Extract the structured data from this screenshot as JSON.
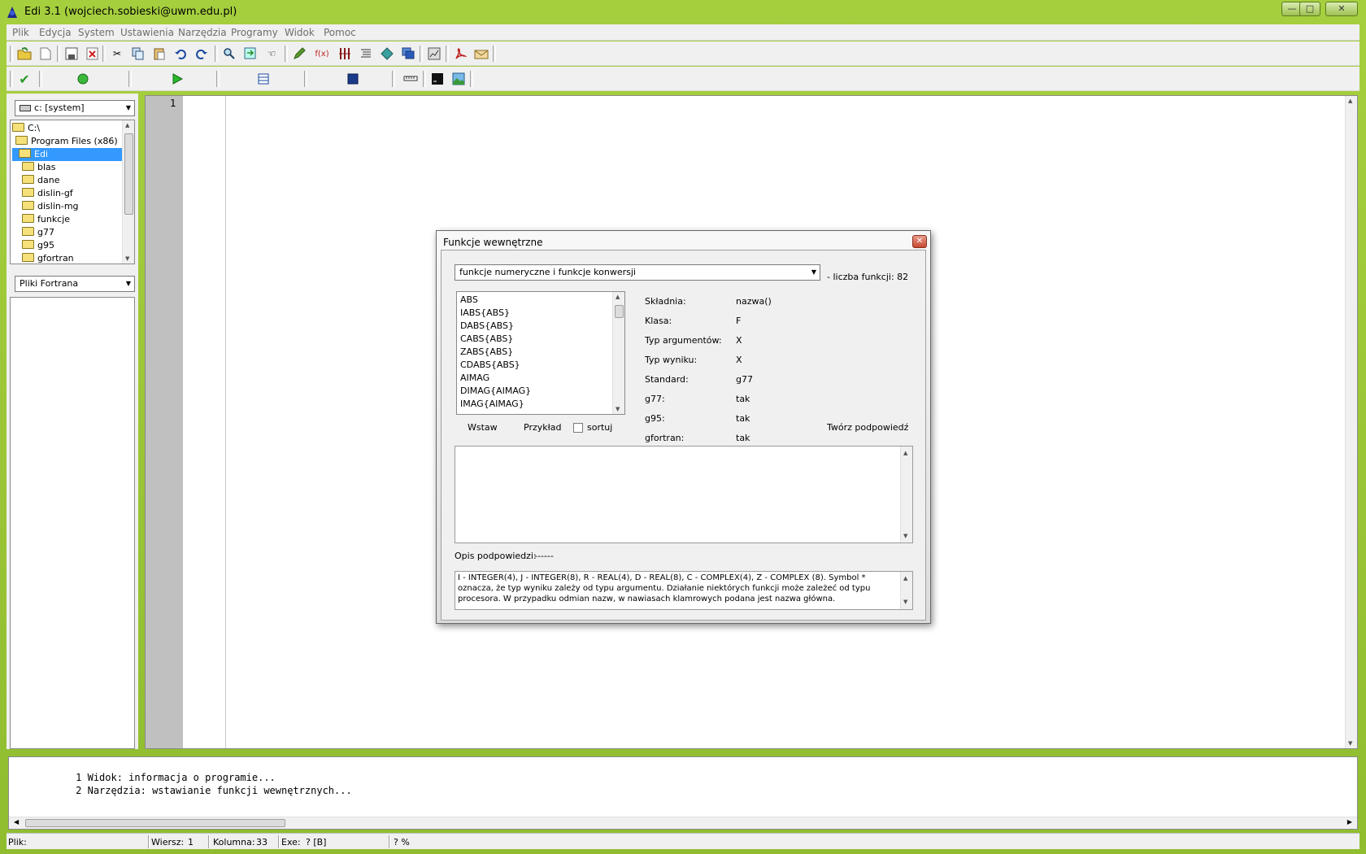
{
  "window": {
    "title": "Edi 3.1 (wojciech.sobieski@uwm.edu.pl)",
    "controls": {
      "minimize": "—",
      "maximize": "□",
      "close": "✕"
    }
  },
  "menu": [
    "Plik",
    "Edycja",
    "System",
    "Ustawienia",
    "Narzędzia",
    "Programy",
    "Widok",
    "Pomoc"
  ],
  "toolbar": {
    "func_icon": "f(x)"
  },
  "left_panel": {
    "drive": "c: [system]",
    "tree": [
      {
        "label": "C:\\",
        "indent": 0,
        "open": true
      },
      {
        "label": "Program Files (x86)",
        "indent": 0,
        "open": true
      },
      {
        "label": "Edi",
        "indent": 1,
        "open": true,
        "selected": true
      },
      {
        "label": "blas",
        "indent": 2
      },
      {
        "label": "dane",
        "indent": 2
      },
      {
        "label": "dislin-gf",
        "indent": 2
      },
      {
        "label": "dislin-mg",
        "indent": 2
      },
      {
        "label": "funkcje",
        "indent": 2
      },
      {
        "label": "g77",
        "indent": 2
      },
      {
        "label": "g95",
        "indent": 2
      },
      {
        "label": "gfortran",
        "indent": 2
      }
    ],
    "filter": "Pliki Fortrana"
  },
  "editor": {
    "line_number": "1"
  },
  "output": {
    "lines": [
      {
        "num": "1",
        "text": "Widok: informacja o programie..."
      },
      {
        "num": "2",
        "text": "Narzędzia: wstawianie funkcji wewnętrznych..."
      }
    ]
  },
  "statusbar": {
    "file_label": "Plik:",
    "row_label": "Wiersz:",
    "row_value": "1",
    "col_label": "Kolumna:",
    "col_value": "33",
    "exe_label": "Exe:",
    "exe_value": "? [B]",
    "percent": "? %"
  },
  "dialog": {
    "title": "Funkcje wewnętrzne",
    "close": "✕",
    "category": "funkcje numeryczne i funkcje konwersji",
    "count_text": "- liczba funkcji: 82",
    "functions": [
      "ABS",
      "IABS{ABS}",
      "DABS{ABS}",
      "CABS{ABS}",
      "ZABS{ABS}",
      "CDABS{ABS}",
      "AIMAG",
      "DIMAG{AIMAG}",
      "IMAG{AIMAG}"
    ],
    "insert": "Wstaw",
    "example": "Przykład",
    "sort": "sortuj",
    "details": [
      {
        "label": "Składnia:",
        "value": "nazwa()"
      },
      {
        "label": "Klasa:",
        "value": "F"
      },
      {
        "label": "Typ argumentów:",
        "value": "X"
      },
      {
        "label": "Typ wyniku:",
        "value": "X"
      },
      {
        "label": "Standard:",
        "value": "g77"
      },
      {
        "label": "g77:",
        "value": "tak"
      },
      {
        "label": "g95:",
        "value": "tak"
      },
      {
        "label": "gfortran:",
        "value": "tak"
      }
    ],
    "create_hint": "Twórz podpowiedź",
    "hint_label": "Opis podpowiedzi:",
    "hint_value": "------",
    "legend": "I - INTEGER(4), J - INTEGER(8), R - REAL(4), D - REAL(8), C - COMPLEX(4), Z - COMPLEX (8). Symbol * oznacza, że typ wyniku zależy od typu argumentu. Działanie niektórych funkcji może zależeć od typu procesora. W przypadku odmian nazw, w nawiasach klamrowych podana jest nazwa główna."
  }
}
